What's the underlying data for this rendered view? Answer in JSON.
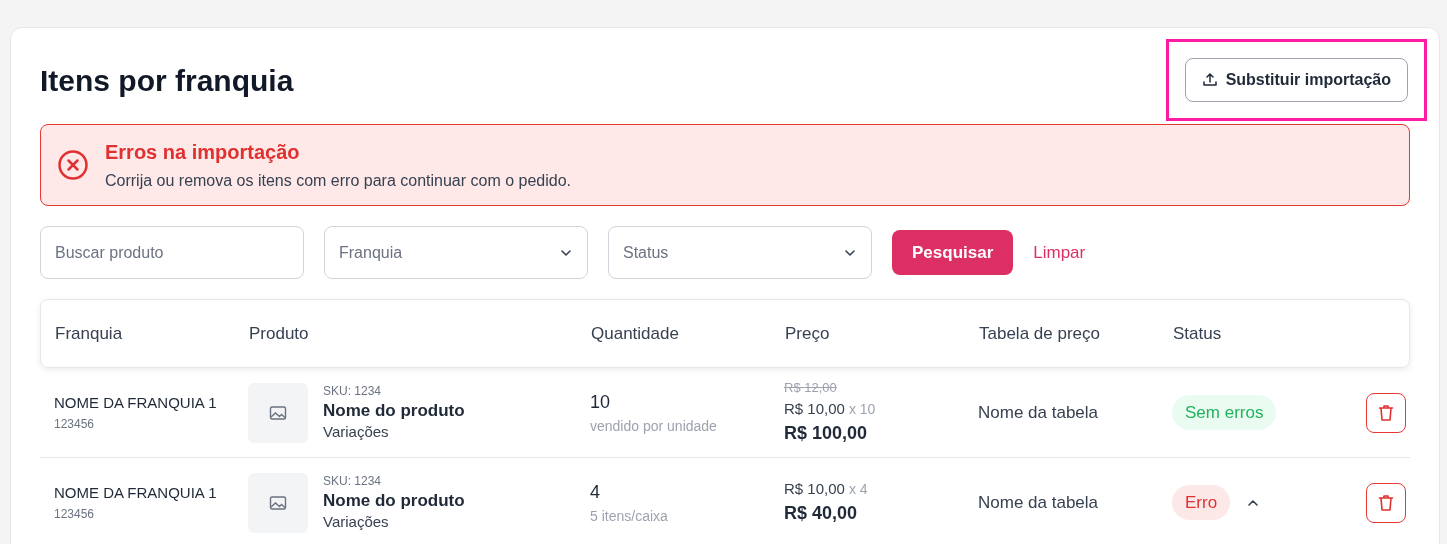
{
  "title": "Itens por franquia",
  "replace_button": {
    "label": "Substituir importação",
    "highlighted": true
  },
  "alert": {
    "title": "Erros na importação",
    "message": "Corrija ou remova os itens com erro para continuar com o pedido."
  },
  "filters": {
    "search": {
      "placeholder": "Buscar produto"
    },
    "franchise": {
      "placeholder": "Franquia"
    },
    "status": {
      "placeholder": "Status"
    },
    "search_button": "Pesquisar",
    "clear_link": "Limpar"
  },
  "table": {
    "columns": [
      "Franquia",
      "Produto",
      "Quantidade",
      "Preço",
      "Tabela de preço",
      "Status"
    ],
    "rows": [
      {
        "franchise": "NOME DA FRANQUIA 1",
        "code": "123456",
        "sku": "SKU: 1234",
        "product": "Nome do produto",
        "variations": "Variações",
        "quantity": "10",
        "quantity_note": "vendido por unidade",
        "old_price": "R$ 12,00",
        "unit_price": "R$ 10,00",
        "multiplier": "x 10",
        "total": "R$ 100,00",
        "price_table": "Nome da tabela",
        "status": {
          "label": "Sem erros",
          "kind": "ok"
        }
      },
      {
        "franchise": "NOME DA FRANQUIA 1",
        "code": "123456",
        "sku": "SKU: 1234",
        "product": "Nome do produto",
        "variations": "Variações",
        "quantity": "4",
        "quantity_note": "5 itens/caixa",
        "unit_price": "R$ 10,00",
        "multiplier": "x 4",
        "total": "R$ 40,00",
        "price_table": "Nome da tabela",
        "status": {
          "label": "Erro",
          "kind": "error",
          "expanded": true
        }
      }
    ]
  }
}
